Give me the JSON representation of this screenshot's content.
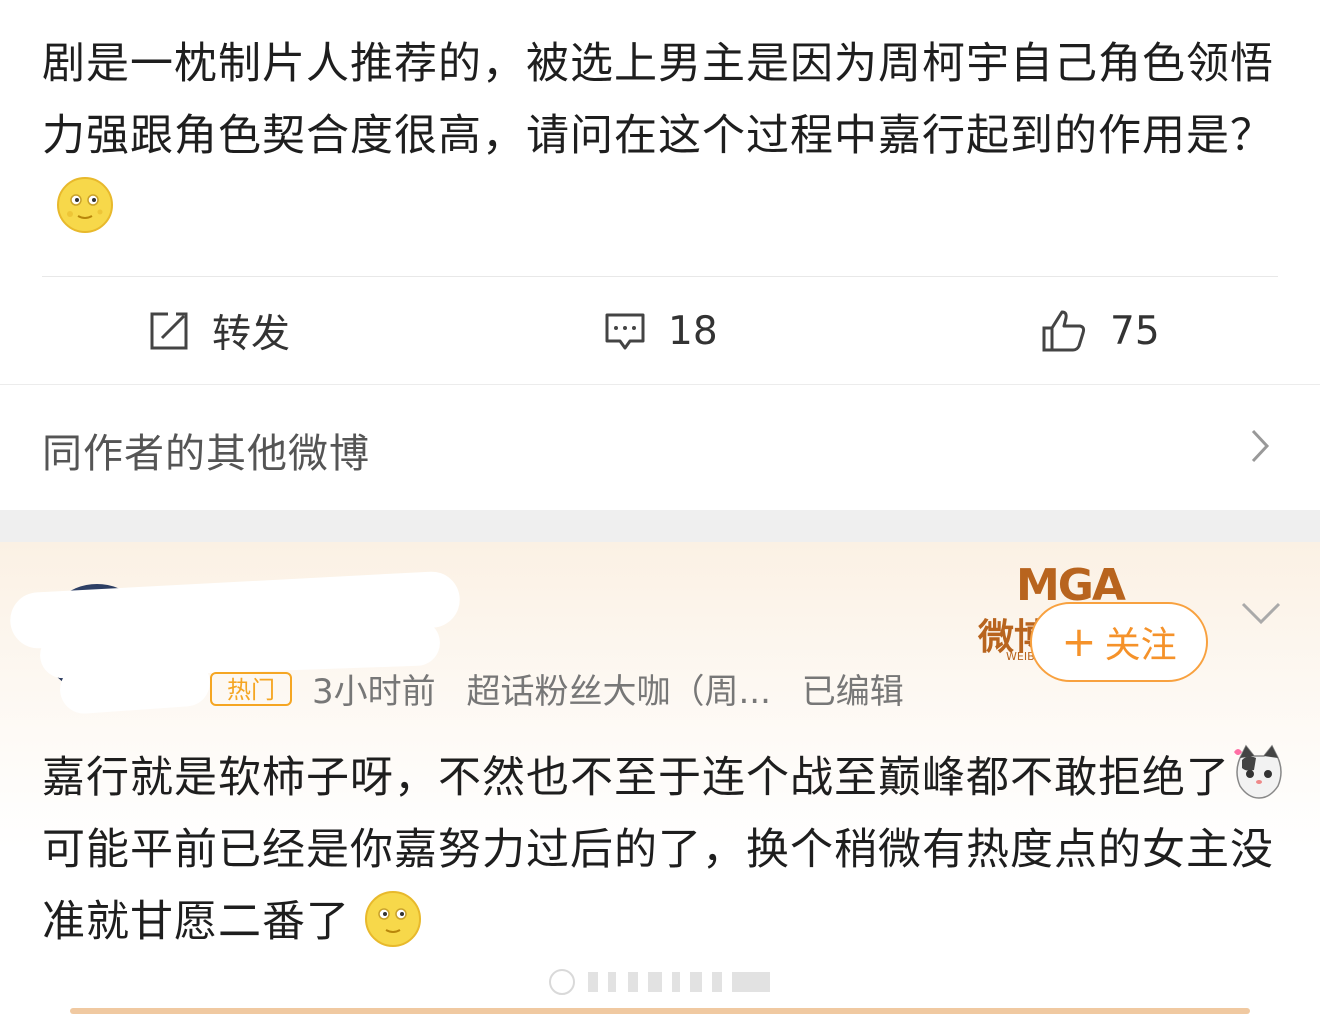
{
  "post": {
    "text": "剧是一枕制片人推荐的，被选上男主是因为周柯宇自己角色领悟力强跟角色契合度很高，请问在这个过程中嘉行起到的作用是？",
    "emoji": "moon-face-emoji"
  },
  "actions": {
    "repost_label": "转发",
    "comment_count": "18",
    "like_count": "75"
  },
  "more": {
    "label": "同作者的其他微博"
  },
  "reply": {
    "badge": "热门",
    "time": "3小时前",
    "tag": "超话粉丝大咖（周...",
    "edited": "已编辑",
    "follow_label": "关注",
    "text_part1": "嘉行就是软柿子呀，不然也不至于连个战至巅峰都不敢拒绝了",
    "text_part2": "可能平前已经是你嘉努力过后的了，换个稍微有热度点的女主没准就甘愿二番了",
    "logo_mga": "MGA",
    "logo_weibo": "微博",
    "logo_small": "WEIBO"
  },
  "colors": {
    "accent": "#f5922a",
    "card_bg": "#fbf1e4"
  }
}
